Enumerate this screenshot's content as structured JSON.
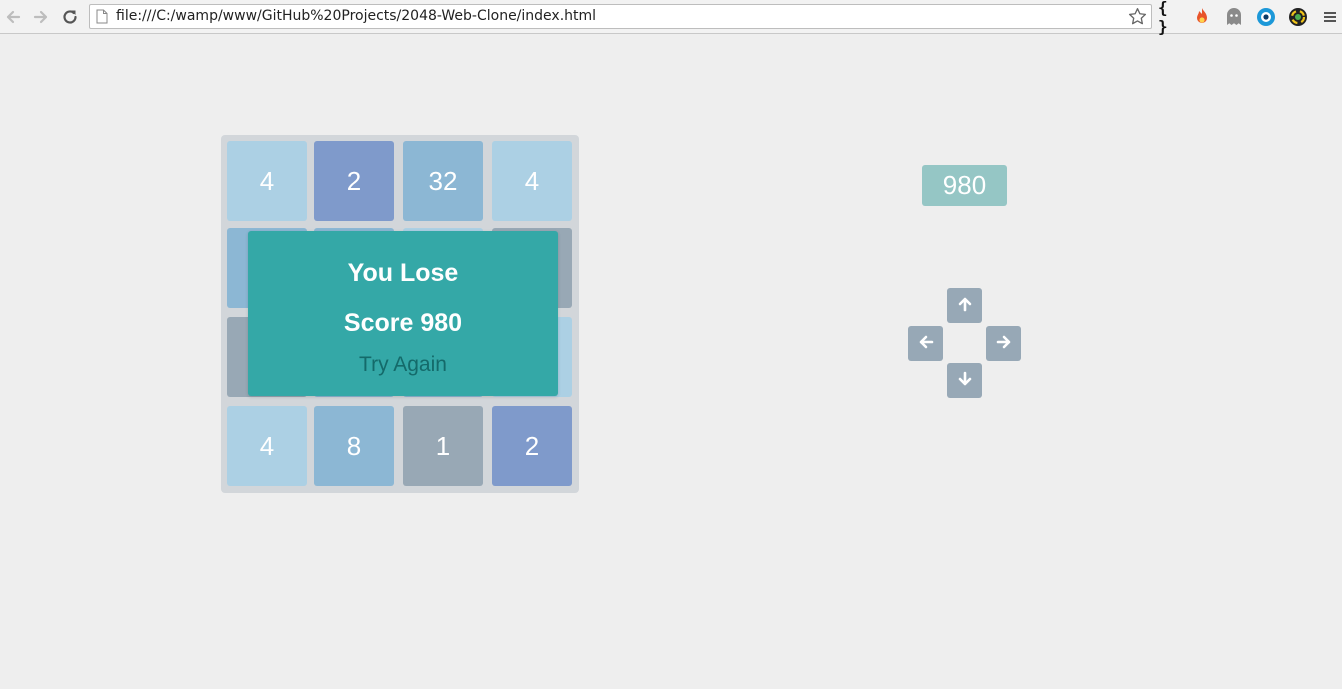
{
  "browser": {
    "url": "file:///C:/wamp/www/GitHub%20Projects/2048-Web-Clone/index.html",
    "extension_braces_label": "{ }",
    "icons": [
      "back-icon",
      "forward-icon",
      "reload-icon",
      "page-icon",
      "star-icon",
      "braces-icon",
      "fire-extension-icon",
      "ghost-extension-icon",
      "eye-extension-icon",
      "chrome-extension-icon",
      "menu-icon"
    ]
  },
  "board": {
    "tiles": [
      {
        "value": "4",
        "shade": "light"
      },
      {
        "value": "2",
        "shade": "dark"
      },
      {
        "value": "32",
        "shade": "mid"
      },
      {
        "value": "4",
        "shade": "light"
      },
      {
        "value": "",
        "shade": "mid"
      },
      {
        "value": "",
        "shade": "mid"
      },
      {
        "value": "",
        "shade": "light"
      },
      {
        "value": "",
        "shade": "grey"
      },
      {
        "value": "",
        "shade": "grey"
      },
      {
        "value": "",
        "shade": "mid"
      },
      {
        "value": "",
        "shade": "mid"
      },
      {
        "value": "",
        "shade": "light"
      },
      {
        "value": "4",
        "shade": "light"
      },
      {
        "value": "8",
        "shade": "mid"
      },
      {
        "value": "1",
        "shade": "grey"
      },
      {
        "value": "2",
        "shade": "dark"
      }
    ]
  },
  "overlay": {
    "title": "You Lose",
    "score_text": "Score 980",
    "retry_label": "Try Again"
  },
  "score": {
    "value": "980"
  },
  "controls": {
    "icons": [
      "arrow-up-icon",
      "arrow-left-icon",
      "arrow-right-icon",
      "arrow-down-icon"
    ]
  },
  "colors": {
    "tile_light": "#acd0e4",
    "tile_mid": "#8cb7d4",
    "tile_dark": "#7f9acb",
    "tile_grey": "#98a8b5",
    "overlay_bg": "#34a8a7",
    "score_bg": "#95c6c5",
    "control_bg": "#97a8b6",
    "board_bg": "#d2d6da"
  }
}
